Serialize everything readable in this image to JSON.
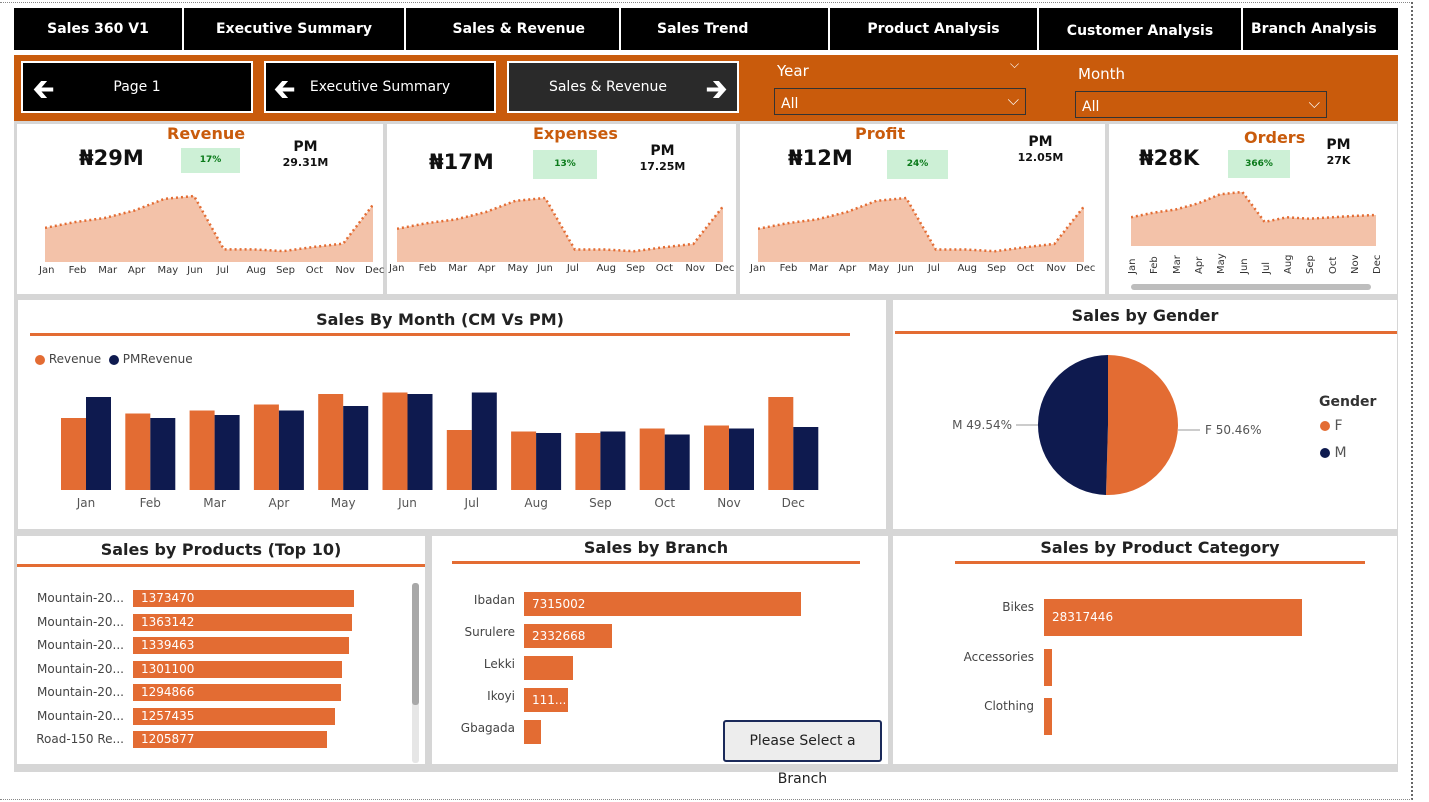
{
  "nav": {
    "tabs": [
      {
        "label": "Sales 360 V1"
      },
      {
        "label": "Executive Summary"
      },
      {
        "label": "Sales & Revenue"
      },
      {
        "label": "Sales Trend"
      },
      {
        "label": "Product Analysis"
      },
      {
        "label": "Customer Analysis"
      },
      {
        "label": "Branch Analysis"
      }
    ]
  },
  "pagers": {
    "page1": "Page 1",
    "executive": "Executive Summary",
    "sales_revenue": "Sales & Revenue"
  },
  "filters": {
    "year": {
      "title": "Year",
      "value": "All"
    },
    "month": {
      "title": "Month",
      "value": "All"
    }
  },
  "kpis": [
    {
      "title": "Revenue",
      "value": "₦29M",
      "change": "17%",
      "pm_label": "PM",
      "pm_value": "29.31M"
    },
    {
      "title": "Expenses",
      "value": "₦17M",
      "change": "13%",
      "pm_label": "PM",
      "pm_value": "17.25M"
    },
    {
      "title": "Profit",
      "value": "₦12M",
      "change": "24%",
      "pm_label": "PM",
      "pm_value": "12.05M"
    },
    {
      "title": "Orders",
      "value": "₦28K",
      "change": "366%",
      "pm_label": "PM",
      "pm_value": "27K"
    }
  ],
  "months": [
    "Jan",
    "Feb",
    "Mar",
    "Apr",
    "May",
    "Jun",
    "Jul",
    "Aug",
    "Sep",
    "Oct",
    "Nov",
    "Dec"
  ],
  "sparklines": [
    [
      0.45,
      0.55,
      0.62,
      0.75,
      0.95,
      1.0,
      0.08,
      0.08,
      0.05,
      0.12,
      0.18,
      0.85
    ],
    [
      0.45,
      0.55,
      0.62,
      0.75,
      0.95,
      1.0,
      0.08,
      0.08,
      0.05,
      0.12,
      0.18,
      0.85
    ],
    [
      0.45,
      0.55,
      0.62,
      0.75,
      0.95,
      1.0,
      0.08,
      0.08,
      0.05,
      0.12,
      0.18,
      0.85
    ],
    [
      0.45,
      0.55,
      0.62,
      0.75,
      0.95,
      1.0,
      0.35,
      0.45,
      0.42,
      0.45,
      0.48,
      0.5
    ]
  ],
  "sales_by_month": {
    "title": "Sales By Month (CM Vs PM)",
    "legend": [
      "Revenue",
      "PMRevenue"
    ],
    "colors": {
      "revenue": "#e36c33",
      "pm": "#0e1a4f"
    },
    "revenue": [
      2.4,
      2.55,
      2.65,
      2.85,
      3.2,
      3.25,
      2.0,
      1.95,
      1.9,
      2.05,
      2.15,
      3.1
    ],
    "pm": [
      3.1,
      2.4,
      2.5,
      2.65,
      2.8,
      3.2,
      3.25,
      1.9,
      1.95,
      1.85,
      2.05,
      2.1
    ]
  },
  "sales_by_gender": {
    "title": "Sales by Gender",
    "legend_title": "Gender",
    "items": [
      {
        "name": "F",
        "pct": 50.46,
        "label": "F 50.46%",
        "color": "#e36c33"
      },
      {
        "name": "M",
        "pct": 49.54,
        "label": "M 49.54%",
        "color": "#0e1a4f"
      }
    ]
  },
  "sales_by_products": {
    "title": "Sales by Products (Top 10)",
    "rows": [
      {
        "name": "Mountain-20...",
        "value": "1373470",
        "v": 1373470
      },
      {
        "name": "Mountain-20...",
        "value": "1363142",
        "v": 1363142
      },
      {
        "name": "Mountain-20...",
        "value": "1339463",
        "v": 1339463
      },
      {
        "name": "Mountain-20...",
        "value": "1301100",
        "v": 1301100
      },
      {
        "name": "Mountain-20...",
        "value": "1294866",
        "v": 1294866
      },
      {
        "name": "Mountain-20...",
        "value": "1257435",
        "v": 1257435
      },
      {
        "name": "Road-150 Re...",
        "value": "1205877",
        "v": 1205877
      }
    ]
  },
  "sales_by_branch": {
    "title": "Sales by Branch",
    "rows": [
      {
        "name": "Ibadan",
        "value": "7315002",
        "v": 7315002
      },
      {
        "name": "Surulere",
        "value": "2332668",
        "v": 2332668
      },
      {
        "name": "Lekki",
        "value": "",
        "v": 1300000
      },
      {
        "name": "Ikoyi",
        "value": "111...",
        "v": 1150000
      },
      {
        "name": "Gbagada",
        "value": "",
        "v": 450000
      }
    ],
    "button": "Please Select a Branch"
  },
  "sales_by_category": {
    "title": "Sales by Product Category",
    "rows": [
      {
        "name": "Bikes",
        "value": "28317446",
        "v": 28317446
      },
      {
        "name": "Accessories",
        "value": "",
        "v": 700000
      },
      {
        "name": "Clothing",
        "value": "",
        "v": 340000
      }
    ]
  }
}
